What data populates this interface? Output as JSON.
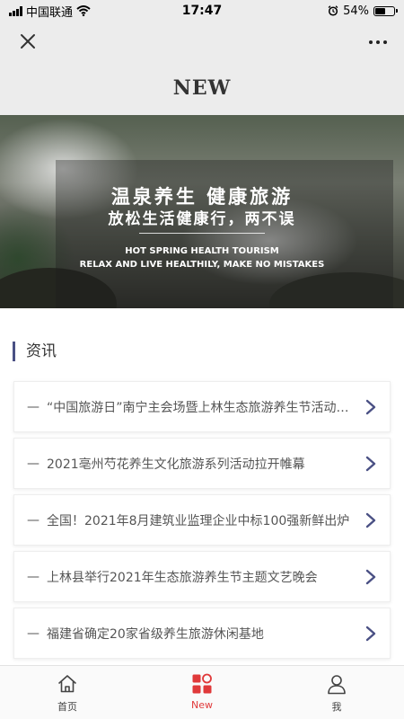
{
  "status_bar": {
    "carrier": "中国联通",
    "time": "17:47",
    "battery_percent": "54%",
    "battery_level": 0.54,
    "icons": [
      "signal-icon",
      "wifi-icon",
      "alarm-icon",
      "battery-icon"
    ]
  },
  "nav": {
    "close_icon": "close-icon",
    "more_icon": "more-icon"
  },
  "page": {
    "title": "NEW"
  },
  "banner": {
    "main_line1": "温泉养生 健康旅游",
    "main_line2": "放松生活健康行，两不误",
    "sub_line1": "HOT SPRING HEALTH TOURISM",
    "sub_line2": "RELAX AND LIVE HEALTHILY, MAKE NO MISTAKES"
  },
  "section": {
    "title": "资讯",
    "accent_color": "#4a5084"
  },
  "news": {
    "dash": "—",
    "items": [
      {
        "title": "“中国旅游日”南宁主会场暨上林生态旅游养生节活动开幕"
      },
      {
        "title": "2021亳州芍花养生文化旅游系列活动拉开帷幕"
      },
      {
        "title": "全国！2021年8月建筑业监理企业中标100强新鲜出炉"
      },
      {
        "title": "上林县举行2021年生态旅游养生节主题文艺晚会"
      },
      {
        "title": "福建省确定20家省级养生旅游休闲基地"
      }
    ]
  },
  "tabbar": {
    "active_color": "#e0393a",
    "items": [
      {
        "label": "首页",
        "icon": "home-icon"
      },
      {
        "label": "New",
        "icon": "grid-icon"
      },
      {
        "label": "我",
        "icon": "user-icon"
      }
    ]
  }
}
